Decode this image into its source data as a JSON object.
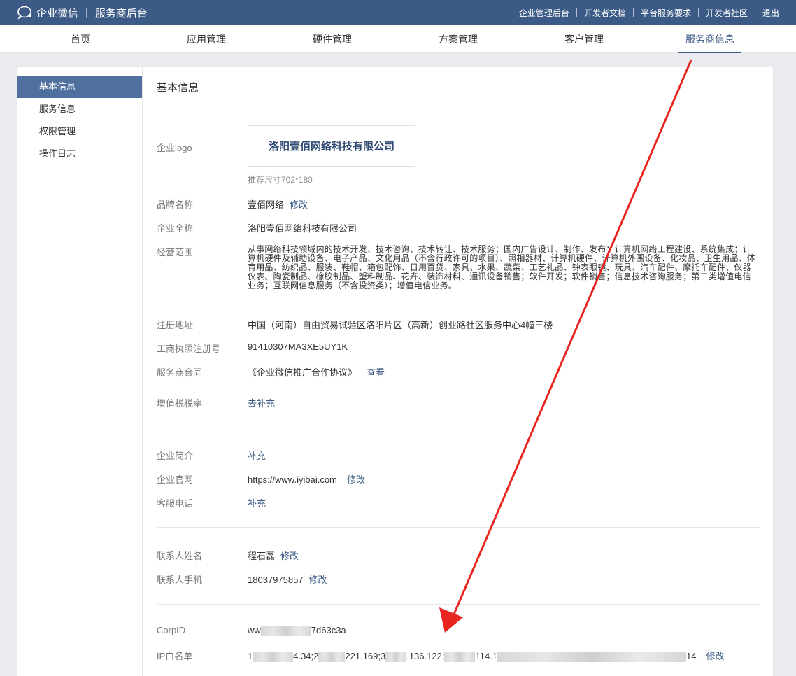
{
  "topbar": {
    "brand_name": "企业微信",
    "portal_name": "服务商后台",
    "links": [
      "企业管理后台",
      "开发者文档",
      "平台服务要求",
      "开发者社区",
      "退出"
    ]
  },
  "nav": {
    "items": [
      "首页",
      "应用管理",
      "硬件管理",
      "方案管理",
      "客户管理",
      "服务商信息"
    ],
    "active": "服务商信息"
  },
  "sidebar": {
    "items": [
      "基本信息",
      "服务信息",
      "权限管理",
      "操作日志"
    ],
    "active": "基本信息"
  },
  "main": {
    "title": "基本信息",
    "logo": {
      "label": "企业logo",
      "text": "洛阳壹佰网络科技有限公司",
      "hint": "推荐尺寸702*180"
    },
    "brand": {
      "label": "品牌名称",
      "value": "壹佰网络",
      "action": "修改"
    },
    "full_name": {
      "label": "企业全称",
      "value": "洛阳壹佰网络科技有限公司"
    },
    "scope": {
      "label": "经营范围",
      "value": "从事网络科技领域内的技术开发、技术咨询、技术转让、技术服务；国内广告设计、制作、发布；计算机网络工程建设、系统集成；计算机硬件及辅助设备、电子产品、文化用品（不含行政许可的项目）、照相器材、计算机硬件、计算机外围设备、化妆品、卫生用品、体育用品、纺织品、服装、鞋帽、箱包配饰、日用百货、家具、水果、蔬菜、工艺礼品、钟表眼镜、玩具、汽车配件、摩托车配件、仪器仪表、陶瓷制品、橡胶制品、塑料制品、花卉、装饰材料、通讯设备销售；软件开发；软件销售；信息技术咨询服务；第二类增值电信业务；互联网信息服务（不含投资类）；增值电信业务。"
    },
    "address": {
      "label": "注册地址",
      "value": "中国（河南）自由贸易试验区洛阳片区（高新）创业路社区服务中心4幢三楼"
    },
    "license": {
      "label": "工商执照注册号",
      "value": "91410307MA3XE5UY1K"
    },
    "contract": {
      "label": "服务商合同",
      "value": "《企业微信推广合作协议》",
      "action": "查看"
    },
    "tax": {
      "label": "增值税税率",
      "action": "去补充"
    },
    "intro": {
      "label": "企业简介",
      "action": "补充"
    },
    "website": {
      "label": "企业官网",
      "value": "https://www.iyibai.com",
      "action": "修改"
    },
    "phone": {
      "label": "客服电话",
      "action": "补充"
    },
    "contact_name": {
      "label": "联系人姓名",
      "value": "程石磊",
      "action": "修改"
    },
    "contact_mobile": {
      "label": "联系人手机",
      "value": "18037975857",
      "action": "修改"
    },
    "corpid": {
      "label": "CorpID",
      "prefix": "ww",
      "suffix": "7d63c3a"
    },
    "ip": {
      "label": "IP白名单",
      "parts": [
        "1",
        "4.34;2",
        "221.169;3",
        ".136.122;",
        "114.1",
        "14"
      ],
      "action": "修改"
    }
  },
  "colors": {
    "topbar": "#3c5a86",
    "accent": "#3c5a86",
    "sidebar_active": "#4f6f9f",
    "arrow": "#e8261f"
  }
}
